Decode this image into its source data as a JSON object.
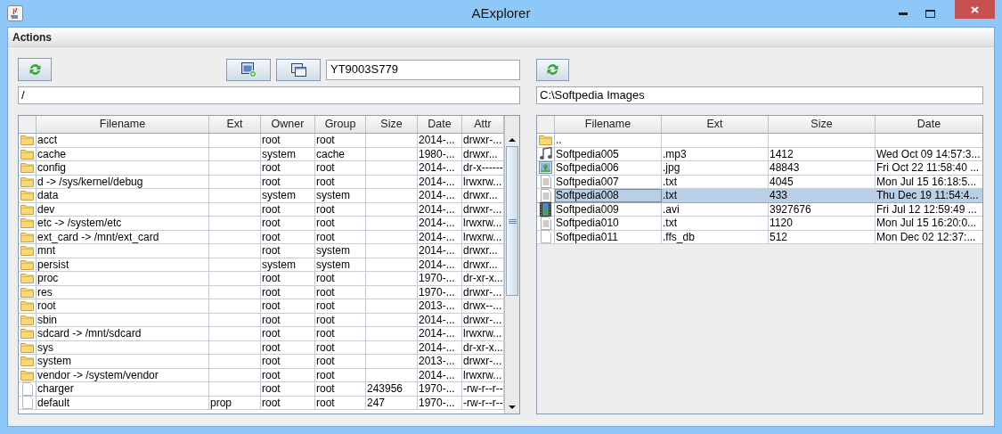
{
  "window": {
    "title": "AExplorer"
  },
  "menu": [
    "Actions"
  ],
  "left": {
    "device": "YT9003S779",
    "path": "/",
    "columns": [
      "Filename",
      "Ext",
      "Owner",
      "Group",
      "Size",
      "Date",
      "Attr"
    ],
    "rows": [
      {
        "kind": "folder",
        "cells": [
          "acct",
          "",
          "root",
          "root",
          "",
          "2014-...",
          "drwxr-..."
        ]
      },
      {
        "kind": "folder",
        "cells": [
          "cache",
          "",
          "system",
          "cache",
          "",
          "1980-...",
          "drwxr..."
        ]
      },
      {
        "kind": "folder",
        "cells": [
          "config",
          "",
          "root",
          "root",
          "",
          "2014-...",
          "dr-x------"
        ]
      },
      {
        "kind": "folder",
        "cells": [
          "d -> /sys/kernel/debug",
          "",
          "root",
          "root",
          "",
          "2014-...",
          "lrwxrw..."
        ]
      },
      {
        "kind": "folder",
        "cells": [
          "data",
          "",
          "system",
          "system",
          "",
          "2014-...",
          "drwxr..."
        ]
      },
      {
        "kind": "folder",
        "cells": [
          "dev",
          "",
          "root",
          "root",
          "",
          "2014-...",
          "drwxr-..."
        ]
      },
      {
        "kind": "folder",
        "cells": [
          "etc -> /system/etc",
          "",
          "root",
          "root",
          "",
          "2014-...",
          "lrwxrw..."
        ]
      },
      {
        "kind": "folder",
        "cells": [
          "ext_card -> /mnt/ext_card",
          "",
          "root",
          "root",
          "",
          "2014-...",
          "lrwxrw..."
        ]
      },
      {
        "kind": "folder",
        "cells": [
          "mnt",
          "",
          "root",
          "system",
          "",
          "2014-...",
          "drwxr..."
        ]
      },
      {
        "kind": "folder",
        "cells": [
          "persist",
          "",
          "system",
          "system",
          "",
          "2014-...",
          "drwxr..."
        ]
      },
      {
        "kind": "folder",
        "cells": [
          "proc",
          "",
          "root",
          "root",
          "",
          "1970-...",
          "dr-xr-x..."
        ]
      },
      {
        "kind": "folder",
        "cells": [
          "res",
          "",
          "root",
          "root",
          "",
          "1970-...",
          "drwxr-..."
        ]
      },
      {
        "kind": "folder",
        "cells": [
          "root",
          "",
          "root",
          "root",
          "",
          "2013-...",
          "drwx--..."
        ]
      },
      {
        "kind": "folder",
        "cells": [
          "sbin",
          "",
          "root",
          "root",
          "",
          "2014-...",
          "drwxr-..."
        ]
      },
      {
        "kind": "folder",
        "cells": [
          "sdcard -> /mnt/sdcard",
          "",
          "root",
          "root",
          "",
          "2014-...",
          "lrwxrw..."
        ]
      },
      {
        "kind": "folder",
        "cells": [
          "sys",
          "",
          "root",
          "root",
          "",
          "2014-...",
          "dr-xr-x..."
        ]
      },
      {
        "kind": "folder",
        "cells": [
          "system",
          "",
          "root",
          "root",
          "",
          "2013-...",
          "drwxr-..."
        ]
      },
      {
        "kind": "folder",
        "cells": [
          "vendor -> /system/vendor",
          "",
          "root",
          "root",
          "",
          "2014-...",
          "lrwxrw..."
        ]
      },
      {
        "kind": "file",
        "cells": [
          "charger",
          "",
          "root",
          "root",
          "243956",
          "1970-...",
          "-rw-r--r--"
        ]
      },
      {
        "kind": "file",
        "cells": [
          "default",
          "prop",
          "root",
          "root",
          "247",
          "1970-...",
          "-rw-r--r--"
        ]
      }
    ]
  },
  "right": {
    "path": "C:\\Softpedia Images",
    "columns": [
      "Filename",
      "Ext",
      "Size",
      "Date"
    ],
    "rows": [
      {
        "kind": "folder",
        "selected": false,
        "cells": [
          "..",
          "",
          "",
          ""
        ]
      },
      {
        "kind": "audio",
        "selected": false,
        "cells": [
          "Softpedia005",
          ".mp3",
          "1412",
          "Wed Oct 09 14:57:3..."
        ]
      },
      {
        "kind": "image",
        "selected": false,
        "cells": [
          "Softpedia006",
          ".jpg",
          "48843",
          "Fri Oct 22 11:58:40 ..."
        ]
      },
      {
        "kind": "text",
        "selected": false,
        "cells": [
          "Softpedia007",
          ".txt",
          "4045",
          "Mon Jul 15 16:18:5..."
        ]
      },
      {
        "kind": "text",
        "selected": true,
        "cells": [
          "Softpedia008",
          ".txt",
          "433",
          "Thu Dec 19 11:54:4..."
        ]
      },
      {
        "kind": "video",
        "selected": false,
        "cells": [
          "Softpedia009",
          ".avi",
          "3927676",
          "Fri Jul 12 12:59:49 ..."
        ]
      },
      {
        "kind": "text",
        "selected": false,
        "cells": [
          "Softpedia010",
          ".txt",
          "1120",
          "Mon Jul 15 16:20:0..."
        ]
      },
      {
        "kind": "file",
        "selected": false,
        "cells": [
          "Softpedia011",
          ".ffs_db",
          "512",
          "Mon Dec 02 12:37:..."
        ]
      }
    ]
  }
}
